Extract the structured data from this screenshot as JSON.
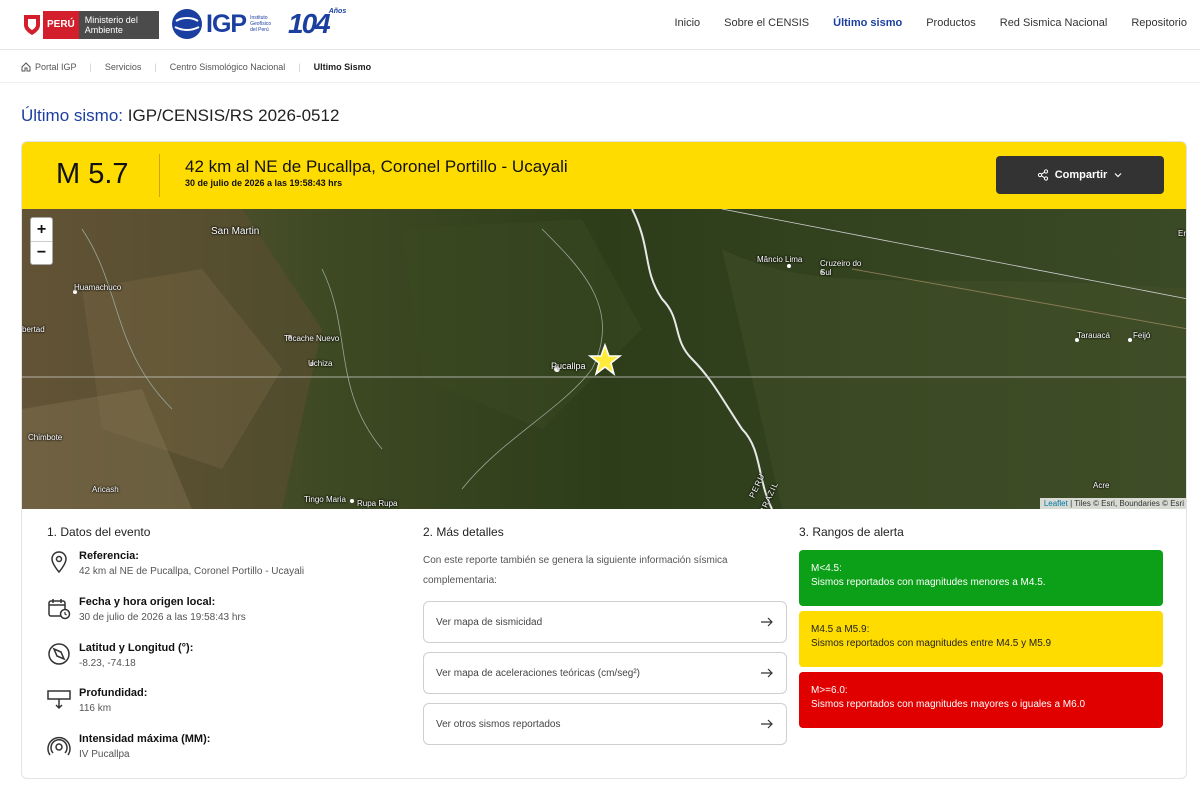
{
  "header": {
    "peru_logo_text": "PERÚ",
    "ministry_text": "Ministerio del Ambiente",
    "igp_text": "IGP",
    "igp_small": "Instituto Geofísico del Perú",
    "anniversary_number": "104",
    "anniversary_suffix": "Años",
    "nav": [
      "Inicio",
      "Sobre el CENSIS",
      "Último sismo",
      "Productos",
      "Red Sismica Nacional",
      "Repositorio"
    ],
    "active_nav": "Último sismo"
  },
  "breadcrumb": [
    "Portal IGP",
    "Servicios",
    "Centro Sismológico Nacional",
    "Ultimo Sismo"
  ],
  "title": {
    "prefix": "Último sismo:",
    "code": "IGP/CENSIS/RS 2026-0512"
  },
  "banner": {
    "magnitude": "M 5.7",
    "place": "42 km al NE de Pucallpa, Coronel Portillo - Ucayali",
    "datetime": "30 de julio de 2026 a las 19:58:43 hrs",
    "share_label": "Compartir",
    "color": "#ffdc00"
  },
  "map": {
    "zoom_in": "+",
    "zoom_out": "−",
    "labels": [
      "San Martin",
      "Huamachuco",
      "bertad",
      "Tocache Nuevo",
      "Uchiza",
      "Pucallpa",
      "Chimbote",
      "Aricash",
      "Tingo Maria",
      "Rupa Rupa",
      "Mâncio Lima",
      "Cruzeiro do Sul",
      "Tarauacá",
      "Feijó",
      "Acre",
      "PERU",
      "BRAZIL",
      "Er"
    ],
    "attribution_leaflet": "Leaflet",
    "attribution_rest": "| Tiles © Esri, Boundaries © Esri"
  },
  "details": {
    "heading": "1. Datos del evento",
    "items": [
      {
        "icon": "location-pin-icon",
        "label": "Referencia:",
        "value": "42 km al NE de Pucallpa, Coronel Portillo - Ucayali"
      },
      {
        "icon": "calendar-clock-icon",
        "label": "Fecha y hora origen local:",
        "value": "30 de julio de 2026 a las 19:58:43 hrs"
      },
      {
        "icon": "compass-icon",
        "label": "Latitud y Longitud (°):",
        "value": "-8.23, -74.18"
      },
      {
        "icon": "depth-icon",
        "label": "Profundidad:",
        "value": "116 km"
      },
      {
        "icon": "intensity-icon",
        "label": "Intensidad máxima (MM):",
        "value": "IV Pucallpa"
      }
    ]
  },
  "more": {
    "heading": "2. Más detalles",
    "description": "Con este reporte también se genera la siguiente información sísmica complementaria:",
    "links": [
      "Ver mapa de sismicidad",
      "Ver mapa de aceleraciones teóricas (cm/seg²)",
      "Ver otros sismos reportados"
    ]
  },
  "alerts": {
    "heading": "3. Rangos de alerta",
    "ranges": [
      {
        "title": "M<4.5:",
        "text": "Sismos reportados con magnitudes menores a M4.5.",
        "color": "#0ca018"
      },
      {
        "title": "M4.5 a M5.9:",
        "text": "Sismos reportados con magnitudes entre M4.5 y M5.9",
        "color": "#ffdc00"
      },
      {
        "title": "M>=6.0:",
        "text": "Sismos reportados con magnitudes mayores o iguales a M6.0",
        "color": "#e00000"
      }
    ]
  }
}
